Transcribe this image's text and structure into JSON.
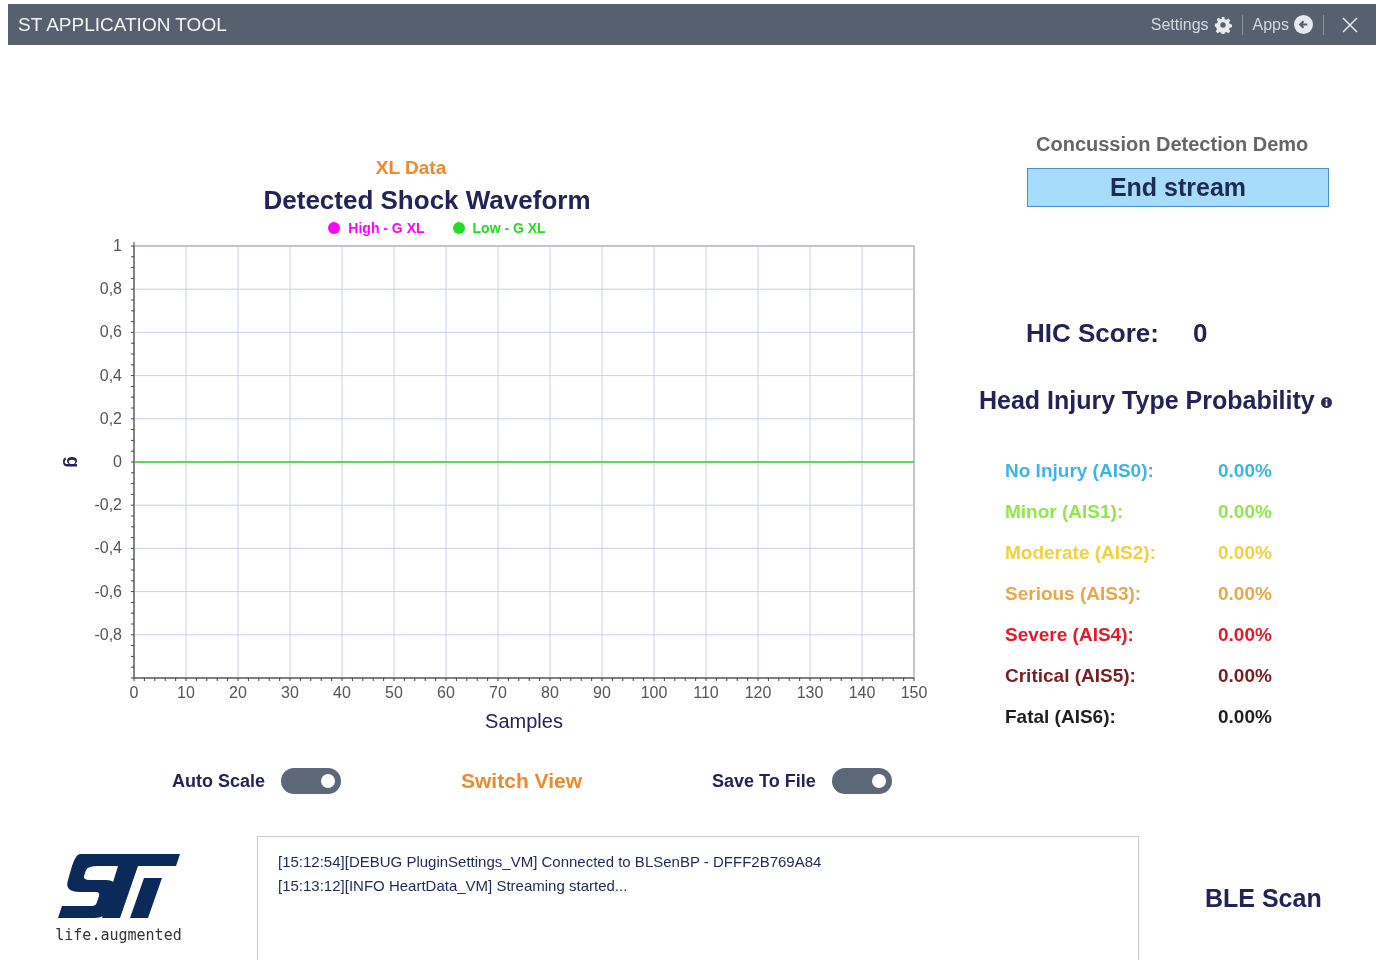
{
  "window": {
    "title": "ST APPLICATION TOOL",
    "actions": [
      {
        "label": "Settings"
      },
      {
        "label": "Apps"
      }
    ]
  },
  "chart": {
    "overline": "XL Data",
    "chart_data": {
      "type": "line",
      "title": "Detected Shock Waveform",
      "xlabel": "Samples",
      "ylabel": "g",
      "x": [
        0,
        150
      ],
      "series": [
        {
          "name": "High - G XL",
          "color": "#ff00ff",
          "values": [
            null,
            null
          ]
        },
        {
          "name": "Low - G XL",
          "color": "#22dd22",
          "values": [
            0,
            0
          ]
        }
      ],
      "xlim": [
        0,
        150
      ],
      "ylim": [
        -1,
        1
      ],
      "grid": true,
      "xticks": [
        0,
        10,
        20,
        30,
        40,
        50,
        60,
        70,
        80,
        90,
        100,
        110,
        120,
        130,
        140,
        150
      ],
      "yticks": [
        {
          "value": 1,
          "label": "1"
        },
        {
          "value": 0.8,
          "label": "0,8"
        },
        {
          "value": 0.6,
          "label": "0,6"
        },
        {
          "value": 0.4,
          "label": "0,4"
        },
        {
          "value": 0.2,
          "label": "0,2"
        },
        {
          "value": 0,
          "label": "0"
        },
        {
          "value": -0.2,
          "label": "-0,2"
        },
        {
          "value": -0.4,
          "label": "-0,4"
        },
        {
          "value": -0.6,
          "label": "-0,6"
        },
        {
          "value": -0.8,
          "label": "-0,8"
        }
      ]
    }
  },
  "controls": [
    {
      "kind": "toggle",
      "label": "Auto Scale",
      "on": true
    },
    {
      "kind": "link",
      "label": "Switch View"
    },
    {
      "kind": "toggle",
      "label": "Save To File",
      "on": true
    }
  ],
  "logo": {
    "tagline": "life.augmented"
  },
  "log": [
    "[15:12:54][DEBUG PluginSettings_VM] Connected to BLSenBP - DFFF2B769A84",
    "[15:13:12][INFO HeartData_VM] Streaming started..."
  ],
  "panel": {
    "demo_title": "Concussion Detection Demo",
    "stream_button": "End stream",
    "hic_label": "HIC Score:",
    "hic_value": "0",
    "probability_title": "Head Injury Type Probability",
    "probabilities": [
      {
        "label": "No Injury (AIS0):",
        "value": "0.00%",
        "color": "#3db4e8"
      },
      {
        "label": "Minor (AIS1):",
        "value": "0.00%",
        "color": "#8ee84a"
      },
      {
        "label": "Moderate (AIS2):",
        "value": "0.00%",
        "color": "#f2d040"
      },
      {
        "label": "Serious (AIS3):",
        "value": "0.00%",
        "color": "#eaa64a"
      },
      {
        "label": "Severe (AIS4):",
        "value": "0.00%",
        "color": "#e01c2c"
      },
      {
        "label": "Critical (AIS5):",
        "value": "0.00%",
        "color": "#7a1c24"
      },
      {
        "label": "Fatal (AIS6):",
        "value": "0.00%",
        "color": "#1e1e1e"
      }
    ],
    "scan_button": "BLE Scan"
  }
}
